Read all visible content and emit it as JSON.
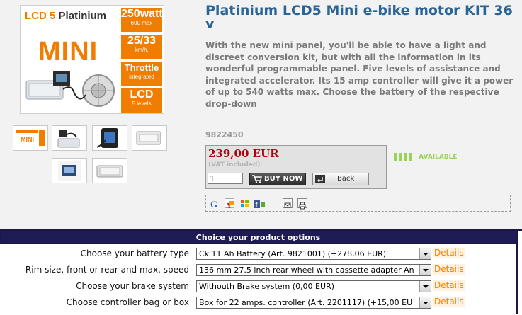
{
  "product": {
    "title": "Platinium LCD5 Mini e-bike motor KIT 36 v",
    "description": "With the new mini panel, you'll be able to have a light and discreet conversion kit, but with all the information in its wonderful programmable panel. Five levels of assistance and integrated accelerator. Its 15 amp controller will give it a power of up to 540 watts max. Choose the battery of the respective drop-down",
    "sku": "9822450"
  },
  "image_banner": {
    "lcd": "LCD 5",
    "platinium": "Platinium",
    "mini": "MINI",
    "tiles": [
      {
        "big": "250watt",
        "small": "600 max"
      },
      {
        "big": "25/33",
        "small": "km/h."
      },
      {
        "big": "Throttle",
        "small": "integrated"
      },
      {
        "big": "LCD",
        "small": "5 levels"
      }
    ]
  },
  "thumbnails": [
    "thumb-kit",
    "thumb-controller",
    "thumb-display",
    "thumb-box",
    "thumb-lcd5-mini-panel",
    "thumb-controller-2"
  ],
  "price": {
    "amount": "239,00 EUR",
    "vat_note": "(VAT included)",
    "quantity": "1",
    "buy_label": "BUY NOW",
    "back_label": "Back"
  },
  "availability": {
    "label": "AVAILABLE",
    "color": "#9ad35a"
  },
  "share_icons": [
    "google-icon",
    "yahoo-icon",
    "windows-live-icon",
    "facebook-icon",
    "email-icon",
    "print-icon"
  ],
  "options": {
    "header": "Choice your product options",
    "details_label": "Details",
    "rows": [
      {
        "label": "Choose your battery type",
        "value": "Ck 11 Ah Battery (Art. 9821001) (+278,06 EUR)"
      },
      {
        "label": "Rim size, front or rear and max. speed",
        "value": "136 mm 27.5 inch rear wheel with cassette adapter An"
      },
      {
        "label": "Choose your brake system",
        "value": "Withouth Brake system (0,00 EUR)"
      },
      {
        "label": "Choose controller bag or box",
        "value": "Box for 22 amps. controller (Art. 2201117) (+15,00 EU"
      }
    ]
  },
  "colors": {
    "title": "#2b6496",
    "price": "#b3000f",
    "accent": "#f07d00",
    "options_header": "#1f1c55",
    "details_link": "#ff7f00"
  }
}
